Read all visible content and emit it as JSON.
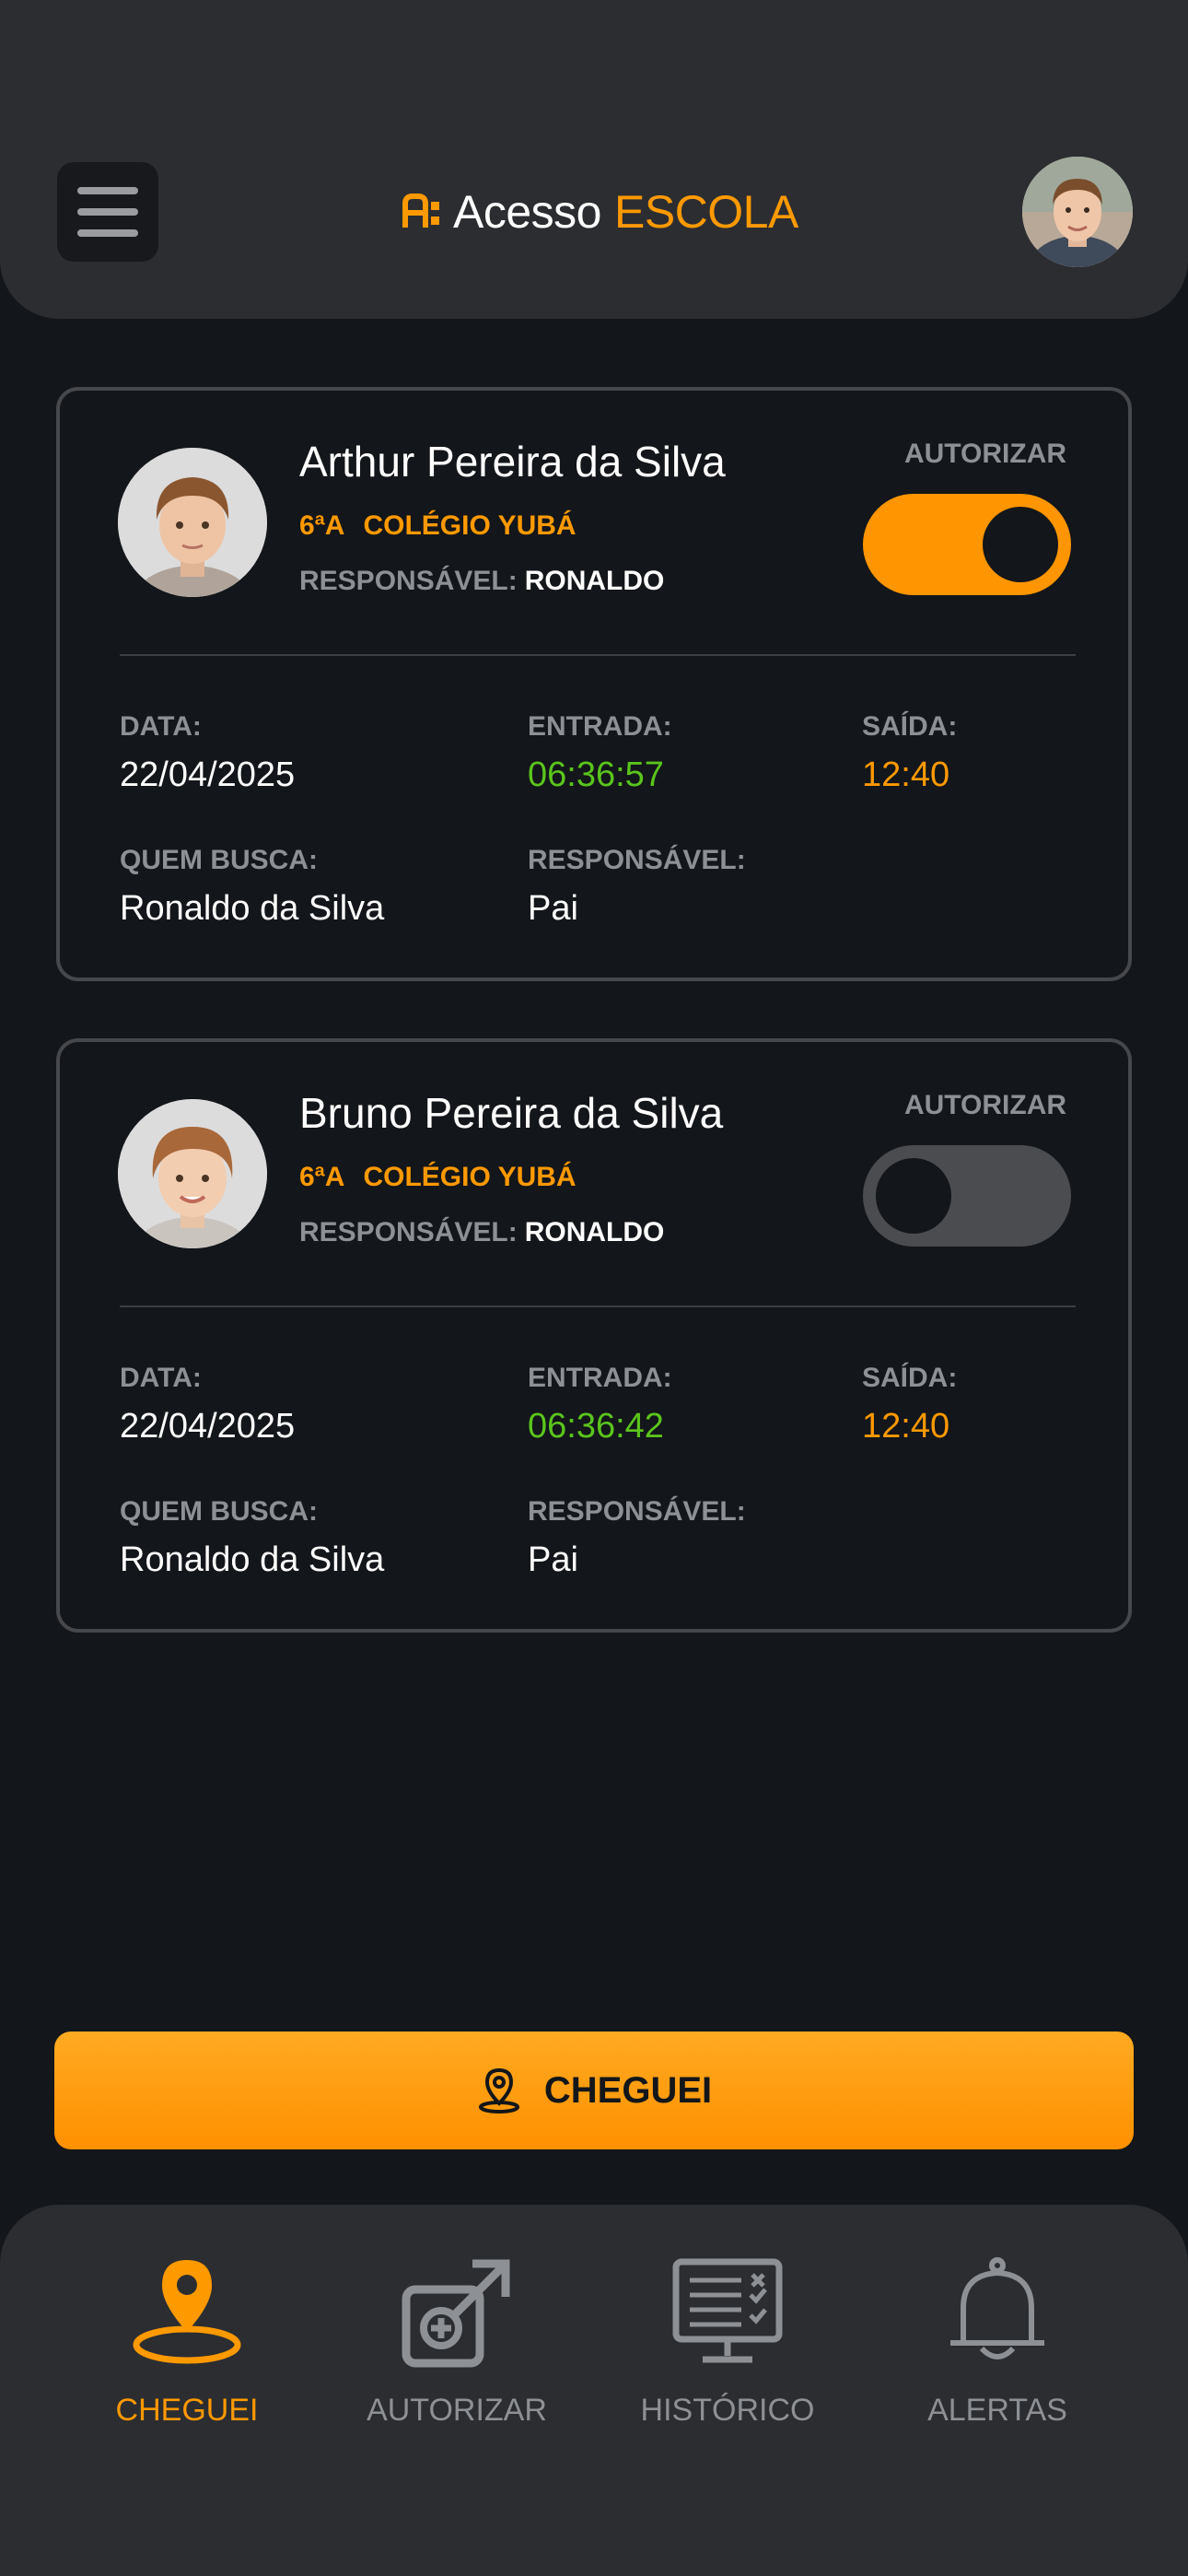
{
  "header": {
    "logo_text_1": "Acesso",
    "logo_text_2": "ESCOLA"
  },
  "cards": [
    {
      "name": "Arthur Pereira da Silva",
      "grade": "6ªA",
      "school": "COLÉGIO YUBÁ",
      "responsible_label": "RESPONSÁVEL:",
      "responsible_value": "RONALDO",
      "authorize_label": "AUTORIZAR",
      "authorized": true,
      "date_label": "DATA:",
      "date": "22/04/2025",
      "entry_label": "ENTRADA:",
      "entry": "06:36:57",
      "exit_label": "SAÍDA:",
      "exit": "12:40",
      "pickup_label": "QUEM BUSCA:",
      "pickup": "Ronaldo da Silva",
      "relation_label": "RESPONSÁVEL:",
      "relation": "Pai"
    },
    {
      "name": "Bruno Pereira da Silva",
      "grade": "6ªA",
      "school": "COLÉGIO YUBÁ",
      "responsible_label": "RESPONSÁVEL:",
      "responsible_value": "RONALDO",
      "authorize_label": "AUTORIZAR",
      "authorized": false,
      "date_label": "DATA:",
      "date": "22/04/2025",
      "entry_label": "ENTRADA:",
      "entry": "06:36:42",
      "exit_label": "SAÍDA:",
      "exit": "12:40",
      "pickup_label": "QUEM BUSCA:",
      "pickup": "Ronaldo da Silva",
      "relation_label": "RESPONSÁVEL:",
      "relation": "Pai"
    }
  ],
  "cta": {
    "label": "CHEGUEI",
    "icon": "map-pin-icon"
  },
  "nav": [
    {
      "label": "CHEGUEI",
      "icon": "map-pin-icon",
      "active": true
    },
    {
      "label": "AUTORIZAR",
      "icon": "authorize-icon",
      "active": false
    },
    {
      "label": "HISTÓRICO",
      "icon": "history-monitor-icon",
      "active": false
    },
    {
      "label": "ALERTAS",
      "icon": "bell-icon",
      "active": false
    }
  ],
  "colors": {
    "accent": "#ff9900",
    "green": "#5ac51c",
    "background": "#13161a",
    "panel": "#2b2d31"
  }
}
